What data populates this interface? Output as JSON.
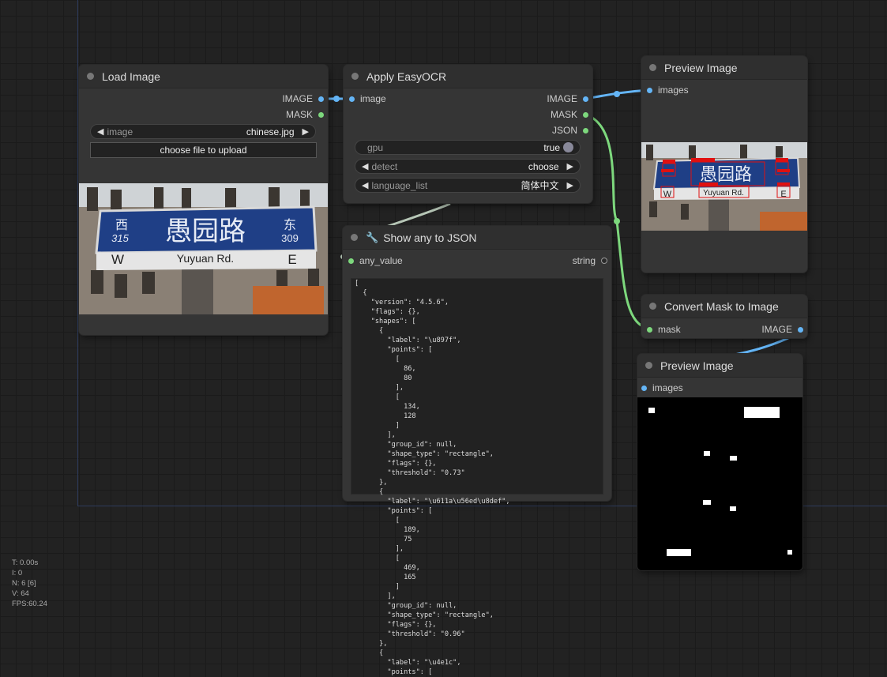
{
  "nodes": {
    "load_image": {
      "title": "Load Image",
      "outputs": [
        "IMAGE",
        "MASK"
      ],
      "image_widget": {
        "label": "image",
        "value": "chinese.jpg"
      },
      "upload_button": "choose file to upload",
      "preview": {
        "sign_chars": "愚园路",
        "west_char": "西",
        "west_num": "315",
        "east_char": "东",
        "east_num": "309",
        "road_name": "Yuyuan Rd.",
        "dir_w": "W",
        "dir_e": "E"
      }
    },
    "apply_easyocr": {
      "title": "Apply EasyOCR",
      "input": "image",
      "outputs": [
        "IMAGE",
        "MASK",
        "JSON"
      ],
      "gpu": {
        "label": "gpu",
        "value": "true"
      },
      "detect": {
        "label": "detect",
        "value": "choose"
      },
      "language_list": {
        "label": "language_list",
        "value": "简体中文"
      }
    },
    "show_any": {
      "title": "Show any to JSON",
      "title_icon": "wrench-icon",
      "input": "any_value",
      "output": "string",
      "json_text": "[\n  {\n    \"version\": \"4.5.6\",\n    \"flags\": {},\n    \"shapes\": [\n      {\n        \"label\": \"\\u897f\",\n        \"points\": [\n          [\n            86,\n            80\n          ],\n          [\n            134,\n            128\n          ]\n        ],\n        \"group_id\": null,\n        \"shape_type\": \"rectangle\",\n        \"flags\": {},\n        \"threshold\": \"0.73\"\n      },\n      {\n        \"label\": \"\\u611a\\u56ed\\u8def\",\n        \"points\": [\n          [\n            189,\n            75\n          ],\n          [\n            469,\n            165\n          ]\n        ],\n        \"group_id\": null,\n        \"shape_type\": \"rectangle\",\n        \"flags\": {},\n        \"threshold\": \"0.96\"\n      },\n      {\n        \"label\": \"\\u4e1c\",\n        \"points\": ["
    },
    "preview_image_1": {
      "title": "Preview Image",
      "input": "images",
      "preview": {
        "sign_chars": "愚园路",
        "road_name": "Yuyuan Rd.",
        "dir_w": "W",
        "dir_e": "E"
      }
    },
    "convert_mask": {
      "title": "Convert Mask to Image",
      "input": "mask",
      "output": "IMAGE"
    },
    "preview_image_2": {
      "title": "Preview Image",
      "input": "images"
    }
  },
  "stats": {
    "t": "T: 0.00s",
    "i": "I: 0",
    "n": "N: 6 [6]",
    "v": "V: 64",
    "fps": "FPS:60.24"
  },
  "colors": {
    "image_wire": "#64b5f6",
    "mask_wire": "#7dd87d",
    "json_wire": "#b7c7b7",
    "canvas": "#222222",
    "node": "#353535"
  }
}
